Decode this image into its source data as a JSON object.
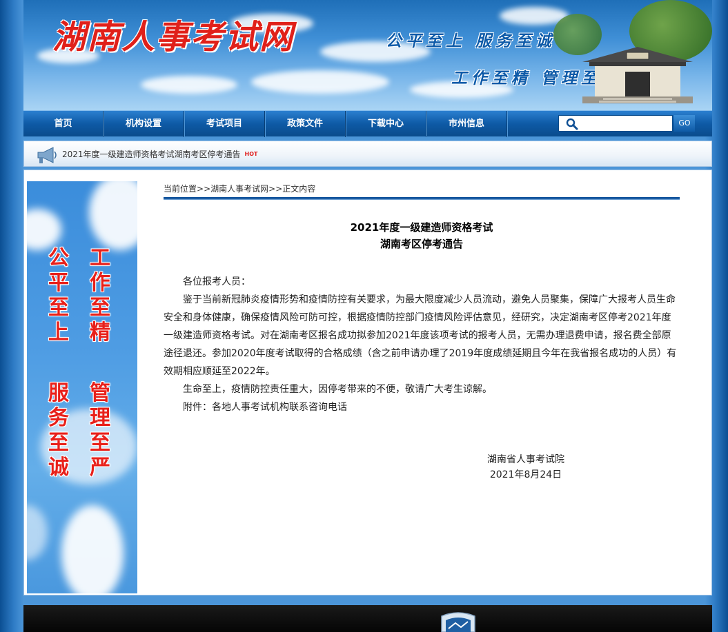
{
  "header": {
    "site_title": "湖南人事考试网",
    "slogan_line1": "公平至上  服务至诚",
    "slogan_line2": "工作至精  管理至严"
  },
  "nav": {
    "items": [
      "首页",
      "机构设置",
      "考试项目",
      "政策文件",
      "下载中心",
      "市州信息"
    ],
    "search_value": "",
    "go_label": "GO"
  },
  "ticker": {
    "text": "2021年度一级建造师资格考试湖南考区停考通告",
    "hot_label": "HOT"
  },
  "sidebar": {
    "col_a": [
      "公",
      "平",
      "至",
      "上"
    ],
    "col_b": [
      "工",
      "作",
      "至",
      "精"
    ],
    "col_c": [
      "服",
      "务",
      "至",
      "诚"
    ],
    "col_d": [
      "管",
      "理",
      "至",
      "严"
    ]
  },
  "breadcrumb": {
    "label": "当前位置",
    "sep1": ">>",
    "site": "湖南人事考试网",
    "sep2": ">>",
    "page": "正文内容"
  },
  "article": {
    "title_line1": "2021年度一级建造师资格考试",
    "title_line2": "湖南考区停考通告",
    "greeting": "各位报考人员：",
    "para1": "鉴于当前新冠肺炎疫情形势和疫情防控有关要求，为最大限度减少人员流动，避免人员聚集，保障广大报考人员生命安全和身体健康，确保疫情风险可防可控，根据疫情防控部门疫情风险评估意见，经研究，决定湖南考区停考2021年度一级建造师资格考试。对在湖南考区报名成功拟参加2021年度该项考试的报考人员，无需办理退费申请，报名费全部原途径退还。参加2020年度考试取得的合格成绩（含之前申请办理了2019年度成绩延期且今年在我省报名成功的人员）有效期相应顺延至2022年。",
    "para2": "生命至上，疫情防控责任重大，因停考带来的不便，敬请广大考生谅解。",
    "attachment": "附件：各地人事考试机构联系咨询电话",
    "signer": "湖南省人事考试院",
    "date": "2021年8月24日"
  }
}
